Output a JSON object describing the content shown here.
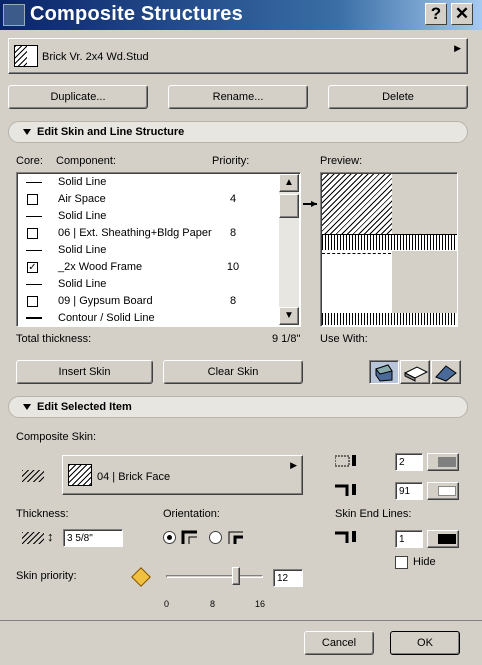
{
  "window": {
    "title": "Composite Structures",
    "help_label": "?",
    "close_label": "✕"
  },
  "top_selector": {
    "value": "Brick Vr. 2x4 Wd.Stud"
  },
  "buttons": {
    "duplicate": "Duplicate...",
    "rename": "Rename...",
    "delete": "Delete"
  },
  "skin_section": {
    "title": "Edit Skin and Line Structure",
    "col_core": "Core:",
    "col_component": "Component:",
    "col_priority": "Priority:",
    "preview_label": "Preview:",
    "rows": [
      {
        "type": "line",
        "label": "Solid Line",
        "priority": ""
      },
      {
        "type": "skin",
        "label": "Air Space",
        "priority": "4",
        "checked": false
      },
      {
        "type": "line",
        "label": "Solid Line",
        "priority": ""
      },
      {
        "type": "skin",
        "label": "06 | Ext. Sheathing+Bldg Paper",
        "priority": "8",
        "checked": false
      },
      {
        "type": "line",
        "label": "Solid Line",
        "priority": ""
      },
      {
        "type": "skin",
        "label": "_2x Wood Frame",
        "priority": "10",
        "checked": true
      },
      {
        "type": "line",
        "label": "Solid Line",
        "priority": ""
      },
      {
        "type": "skin",
        "label": "09 | Gypsum Board",
        "priority": "8",
        "checked": false
      },
      {
        "type": "contour",
        "label": "Contour /  Solid Line",
        "priority": ""
      }
    ],
    "total_label": "Total thickness:",
    "total_value": "9 1/8\"",
    "use_with_label": "Use With:",
    "insert_skin": "Insert Skin",
    "clear_skin": "Clear Skin"
  },
  "selected_section": {
    "title": "Edit Selected Item",
    "composite_skin_label": "Composite Skin:",
    "composite_skin_value": "04 | Brick Face",
    "thickness_label": "Thickness:",
    "thickness_value": "3 5/8\"",
    "orientation_label": "Orientation:",
    "skin_end_lines_label": "Skin End Lines:",
    "pen_top": "2",
    "pen_mid": "91",
    "pen_end": "1",
    "hide_label": "Hide",
    "skin_priority_label": "Skin priority:",
    "slider_value": 12,
    "slider_min": "0",
    "slider_mid": "8",
    "slider_max": "16",
    "priority_field": "12"
  },
  "footer": {
    "cancel": "Cancel",
    "ok": "OK"
  },
  "icons": [
    "app-icon",
    "help-icon",
    "close-icon",
    "wall-icon",
    "slab-icon",
    "roof-icon",
    "lock-icon"
  ]
}
